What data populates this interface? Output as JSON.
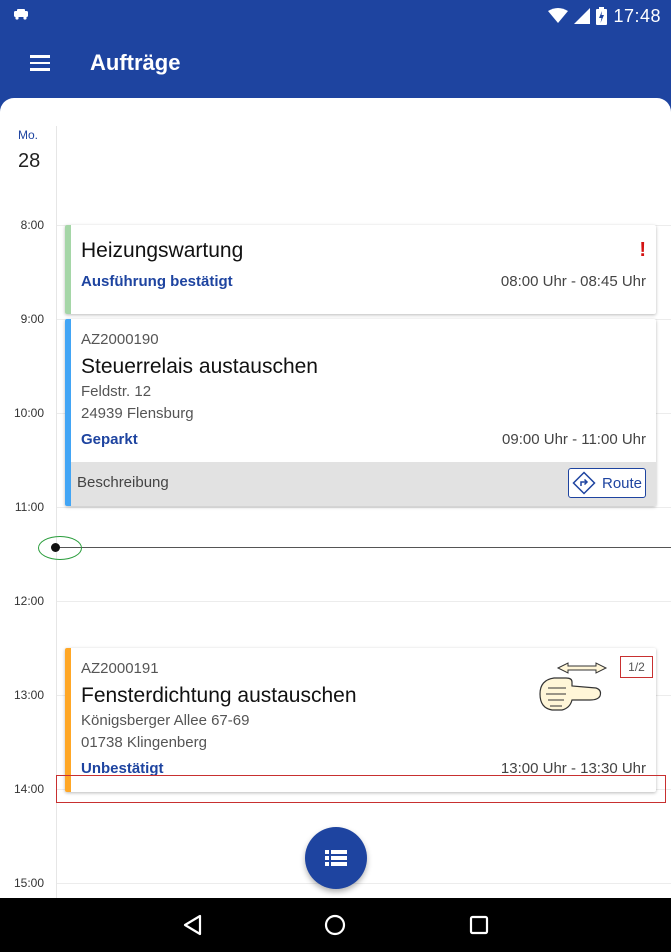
{
  "status_bar": {
    "time": "17:48",
    "icons": [
      "car-notification-icon",
      "wifi-icon",
      "signal-icon",
      "battery-icon"
    ]
  },
  "app_bar": {
    "title": "Aufträge",
    "menu_icon": "hamburger-menu-icon"
  },
  "calendar": {
    "day_name": "Mo.",
    "day_number": "28",
    "hours": [
      "8:00",
      "9:00",
      "10:00",
      "11:00",
      "12:00",
      "13:00",
      "14:00",
      "15:00"
    ],
    "events": [
      {
        "title": "Heizungswartung",
        "status": "Ausführung bestätigt",
        "time": "08:00 Uhr - 08:45 Uhr",
        "warning": "!",
        "accent": "#a5d6a7"
      },
      {
        "order": "AZ2000190",
        "title": "Steuerrelais austauschen",
        "street": "Feldstr. 12",
        "city": "24939 Flensburg",
        "status": "Geparkt",
        "time": "09:00 Uhr - 11:00 Uhr",
        "description_label": "Beschreibung",
        "route_label": "Route",
        "accent": "#42a5f5"
      },
      {
        "order": "AZ2000191",
        "title": "Fensterdichtung austauschen",
        "street": "Königsberger Allee 67-69",
        "city": "01738 Klingenberg",
        "status": "Unbestätigt",
        "time": "13:00 Uhr - 13:30 Uhr",
        "pager": "1/2",
        "accent": "#ffa726"
      }
    ]
  },
  "fab": {
    "icon": "list-icon"
  },
  "nav_bar": {
    "icons": [
      "back-icon",
      "home-icon",
      "recents-icon"
    ]
  },
  "colors": {
    "primary": "#1e44a0",
    "warning": "#d41212",
    "now_ring": "#2a9d3c"
  }
}
